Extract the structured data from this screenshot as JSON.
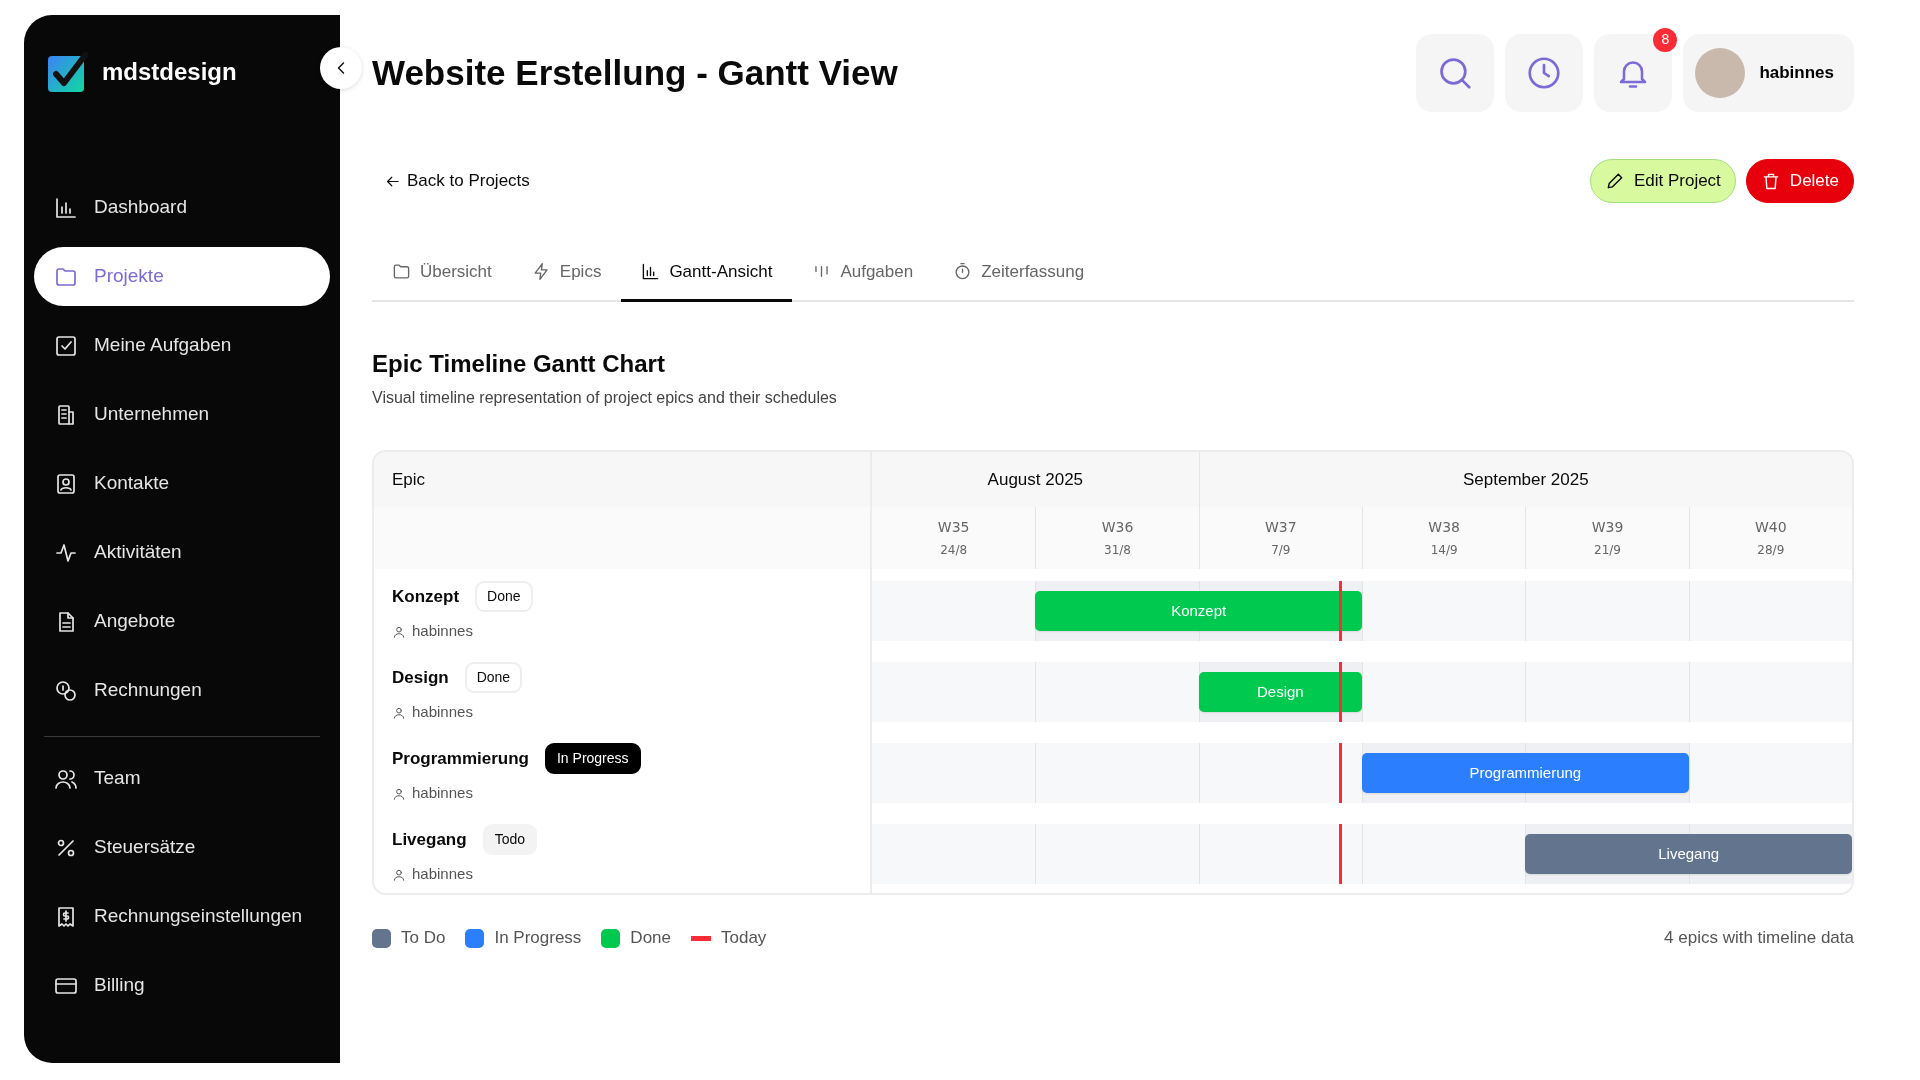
{
  "sidebar": {
    "brand": "mdstdesign",
    "nav_main": [
      {
        "label": "Dashboard",
        "selected": false
      },
      {
        "label": "Projekte",
        "selected": true
      },
      {
        "label": "Meine Aufgaben",
        "selected": false
      },
      {
        "label": "Unternehmen",
        "selected": false
      },
      {
        "label": "Kontakte",
        "selected": false
      },
      {
        "label": "Aktivitäten",
        "selected": false
      },
      {
        "label": "Angebote",
        "selected": false
      },
      {
        "label": "Rechnungen",
        "selected": false
      }
    ],
    "nav_settings": [
      {
        "label": "Team",
        "selected": false
      },
      {
        "label": "Steuersätze",
        "selected": false
      },
      {
        "label": "Rechnungseinstellungen",
        "selected": false
      },
      {
        "label": "Billing",
        "selected": false
      }
    ]
  },
  "header": {
    "title": "Website Erstellung - Gantt View",
    "notification_count": "8",
    "user": "habinnes"
  },
  "back_link": "Back to Projects",
  "actions": [
    {
      "label": "Edit Project",
      "kind": "edit"
    },
    {
      "label": "Delete",
      "kind": "delete"
    }
  ],
  "tabs": [
    {
      "label": "Übersicht",
      "selected": false
    },
    {
      "label": "Epics",
      "selected": false
    },
    {
      "label": "Gantt-Ansicht",
      "selected": true
    },
    {
      "label": "Aufgaben",
      "selected": false
    },
    {
      "label": "Zeiterfassung",
      "selected": false
    }
  ],
  "section": {
    "title": "Epic Timeline Gantt Chart",
    "subtitle": "Visual timeline representation of project epics and their schedules"
  },
  "gantt": {
    "epic_column": "Epic",
    "months": [
      {
        "label": "August 2025",
        "weeks": [
          {
            "label": "W35",
            "date": "24/8"
          },
          {
            "label": "W36",
            "date": "31/8"
          }
        ]
      },
      {
        "label": "September 2025",
        "weeks": [
          {
            "label": "W37",
            "date": "7/9"
          },
          {
            "label": "W38",
            "date": "14/9"
          },
          {
            "label": "W39",
            "date": "21/9"
          },
          {
            "label": "W40",
            "date": "28/9"
          }
        ]
      }
    ],
    "today_marker": {
      "level": 0.477
    },
    "epics": [
      {
        "name": "Konzept",
        "status": "Done",
        "kind": "done",
        "owner": "habinnes",
        "bar_label": "Konzept",
        "color": "#00c950",
        "weeks_covered": [
          false,
          true,
          true,
          false,
          false,
          false
        ]
      },
      {
        "name": "Design",
        "status": "Done",
        "kind": "done",
        "owner": "habinnes",
        "bar_label": "Design",
        "color": "#00c950",
        "weeks_covered": [
          false,
          false,
          true,
          false,
          false,
          false
        ]
      },
      {
        "name": "Programmierung",
        "status": "In Progress",
        "kind": "progress",
        "owner": "habinnes",
        "bar_label": "Programmierung",
        "color": "#2b7fff",
        "weeks_covered": [
          false,
          false,
          false,
          true,
          true,
          false
        ]
      },
      {
        "name": "Livegang",
        "status": "Todo",
        "kind": "todo",
        "owner": "habinnes",
        "bar_label": "Livegang",
        "color": "#62748e",
        "weeks_covered": [
          false,
          false,
          false,
          false,
          true,
          true
        ]
      }
    ]
  },
  "legend": [
    {
      "label": "To Do",
      "kind": "swatch",
      "color": "#62748e"
    },
    {
      "label": "In Progress",
      "kind": "swatch",
      "color": "#2b7fff"
    },
    {
      "label": "Done",
      "kind": "swatch",
      "color": "#00c950"
    },
    {
      "label": "Today",
      "kind": "line",
      "color": "#fb2c36"
    }
  ],
  "summary": "4 epics with timeline data"
}
